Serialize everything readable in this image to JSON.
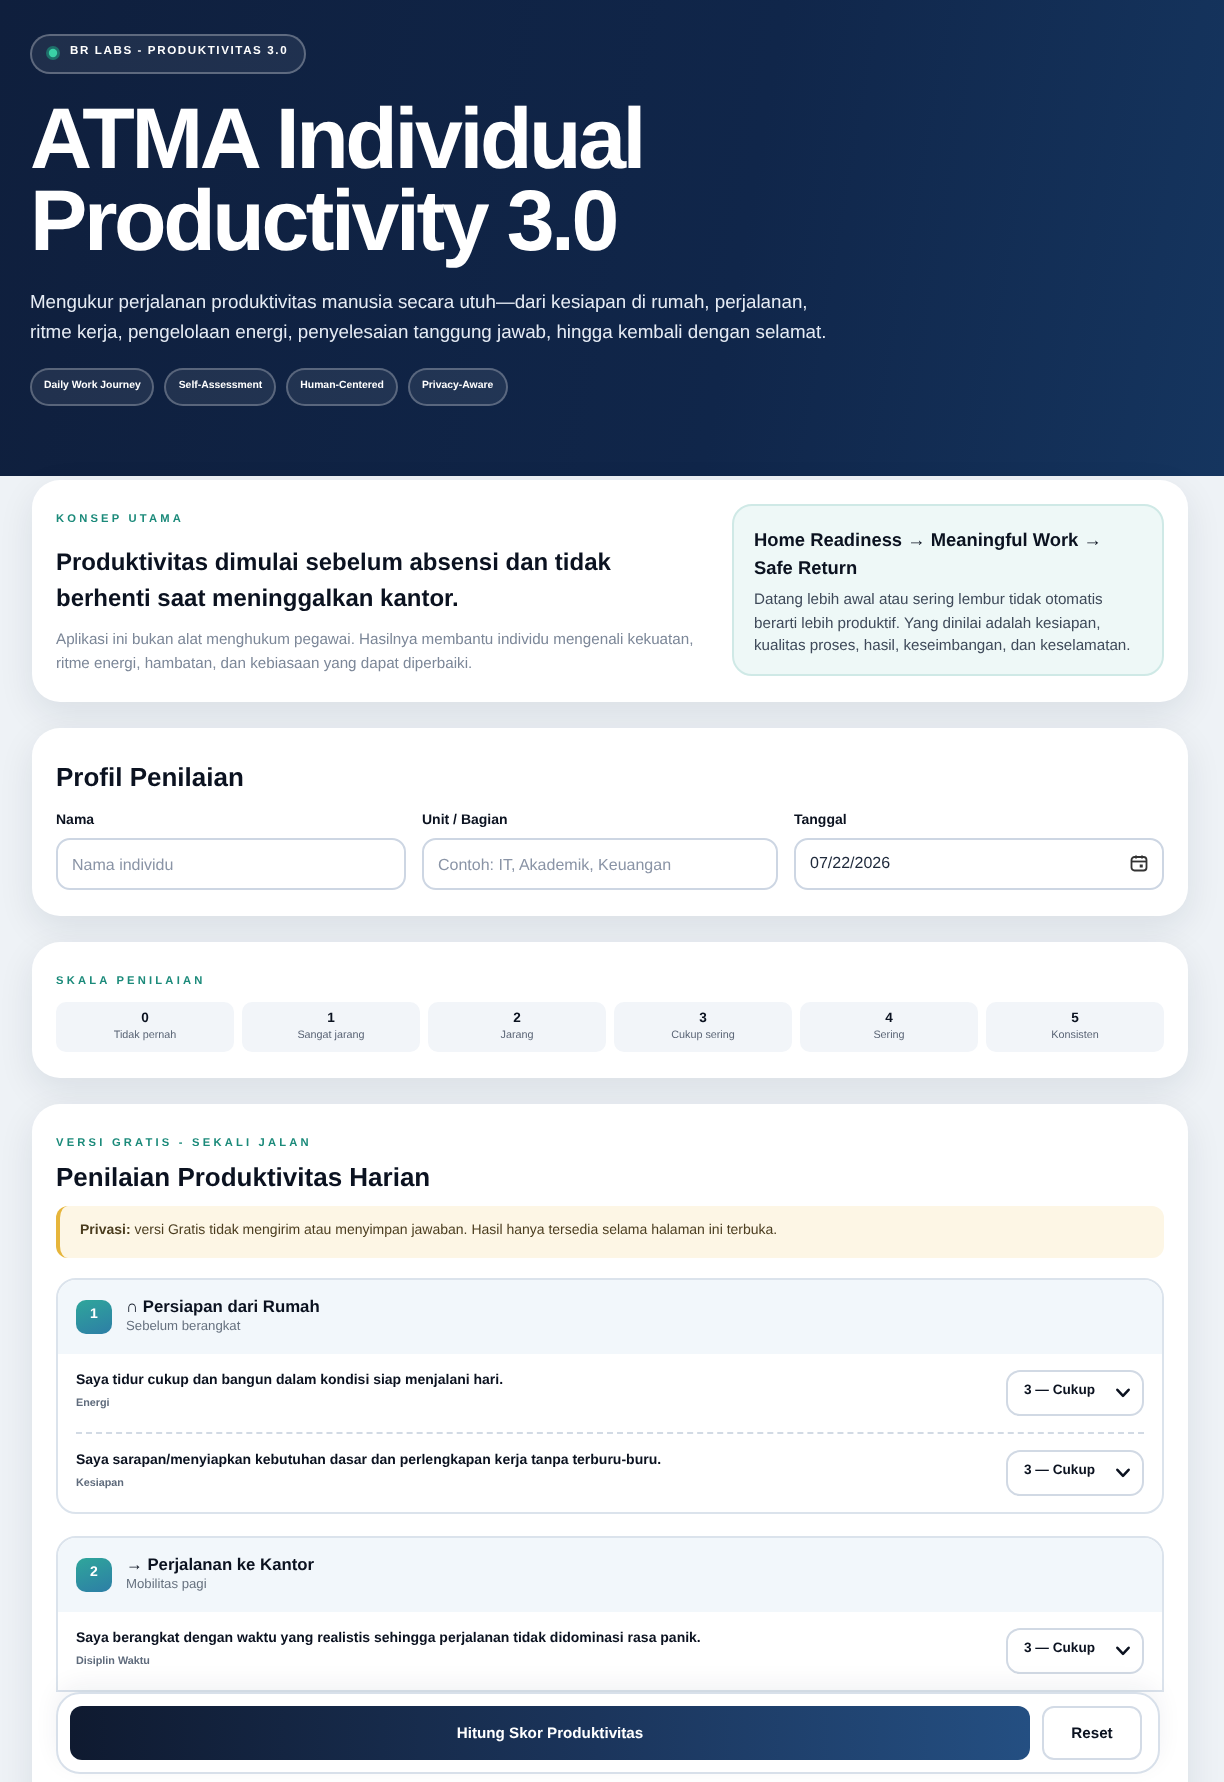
{
  "hero": {
    "badge": "BR LABS - PRODUKTIVITAS 3.0",
    "title": "ATMA Individual Productivity 3.0",
    "description": "Mengukur perjalanan produktivitas manusia secara utuh—dari kesiapan di rumah, perjalanan, ritme kerja, pengelolaan energi, penyelesaian tanggung jawab, hingga kembali dengan selamat.",
    "tags": [
      "Daily Work Journey",
      "Self-Assessment",
      "Human-Centered",
      "Privacy-Aware"
    ]
  },
  "concept": {
    "eyebrow": "KONSEP UTAMA",
    "heading": "Produktivitas dimulai sebelum absensi dan tidak berhenti saat meninggalkan kantor.",
    "text": "Aplikasi ini bukan alat menghukum pegawai. Hasilnya membantu individu mengenali kekuatan, ritme energi, hambatan, dan kebiasaan yang dapat diperbaiki.",
    "highlight": {
      "title": "Home Readiness → Meaningful Work → Safe Return",
      "text": "Datang lebih awal atau sering lembur tidak otomatis berarti lebih produktif. Yang dinilai adalah kesiapan, kualitas proses, hasil, keseimbangan, dan keselamatan."
    }
  },
  "profile": {
    "title": "Profil Penilaian",
    "fields": [
      {
        "label": "Nama",
        "kind": "text",
        "placeholder": "Nama individu"
      },
      {
        "label": "Unit / Bagian",
        "kind": "text",
        "placeholder": "Contoh: IT, Akademik, Keuangan"
      },
      {
        "label": "Tanggal",
        "kind": "date",
        "value": "07/22/2026"
      }
    ]
  },
  "scale": {
    "eyebrow": "SKALA PENILAIAN",
    "levels": [
      {
        "value": "0",
        "label": "Tidak pernah"
      },
      {
        "value": "1",
        "label": "Sangat jarang"
      },
      {
        "value": "2",
        "label": "Jarang"
      },
      {
        "value": "3",
        "label": "Cukup sering"
      },
      {
        "value": "4",
        "label": "Sering"
      },
      {
        "value": "5",
        "label": "Konsisten"
      }
    ]
  },
  "assessment": {
    "eyebrow": "VERSI GRATIS - SEKALI JALAN",
    "title": "Penilaian Produktivitas Harian",
    "notice": "**Privasi:** versi Gratis tidak mengirim atau menyimpan jawaban. Hasil hanya tersedia selama halaman ini terbuka.",
    "sections": [
      {
        "number": "1",
        "title": "∩ Persiapan dari Rumah",
        "subtitle": "Sebelum berangkat",
        "questions": [
          {
            "text": "Saya tidur cukup dan bangun dalam kondisi siap menjalani hari.",
            "category": "Energi",
            "answer": "3 — Cukup"
          },
          {
            "text": "Saya sarapan/menyiapkan kebutuhan dasar dan perlengkapan kerja tanpa terburu-buru.",
            "category": "Kesiapan",
            "answer": "3 — Cukup"
          }
        ]
      },
      {
        "number": "2",
        "title": "→ Perjalanan ke Kantor",
        "subtitle": "Mobilitas pagi",
        "questions": [
          {
            "text": "Saya berangkat dengan waktu yang realistis sehingga perjalanan tidak didominasi rasa panik.",
            "category": "Disiplin Waktu",
            "answer": "3 — Cukup"
          }
        ]
      }
    ]
  },
  "actions": {
    "primary": "Hitung Skor Produktivitas",
    "secondary": "Reset"
  }
}
